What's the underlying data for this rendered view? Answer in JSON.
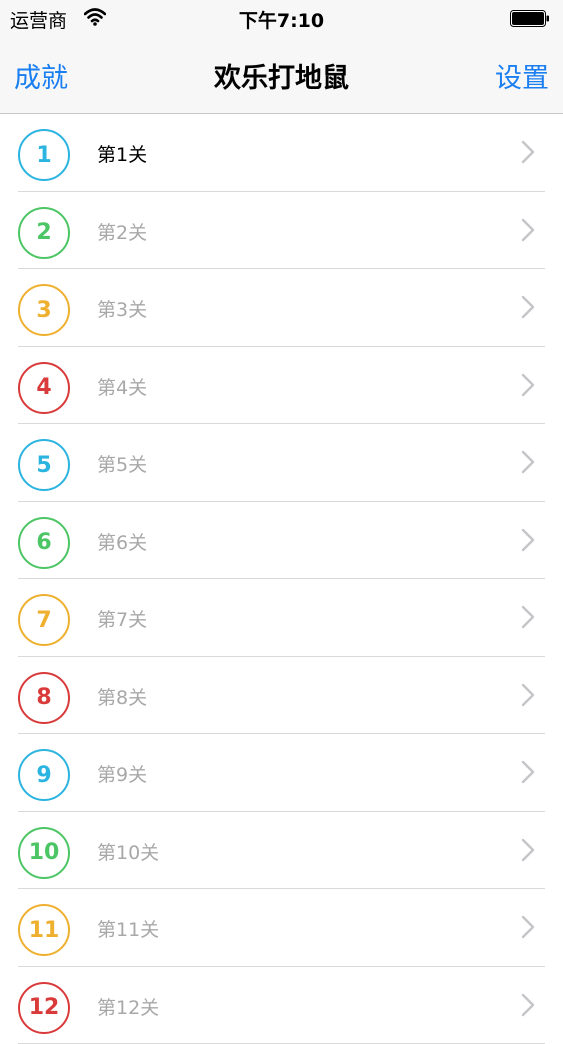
{
  "status": {
    "carrier": "运营商",
    "time": "下午7:10"
  },
  "nav": {
    "left": "成就",
    "title": "欢乐打地鼠",
    "right": "设置"
  },
  "palette": [
    "#2cb4e0",
    "#4cc564",
    "#efb030",
    "#d93a3a"
  ],
  "levels": [
    {
      "num": "1",
      "label": "第1关",
      "unlocked": true
    },
    {
      "num": "2",
      "label": "第2关",
      "unlocked": false
    },
    {
      "num": "3",
      "label": "第3关",
      "unlocked": false
    },
    {
      "num": "4",
      "label": "第4关",
      "unlocked": false
    },
    {
      "num": "5",
      "label": "第5关",
      "unlocked": false
    },
    {
      "num": "6",
      "label": "第6关",
      "unlocked": false
    },
    {
      "num": "7",
      "label": "第7关",
      "unlocked": false
    },
    {
      "num": "8",
      "label": "第8关",
      "unlocked": false
    },
    {
      "num": "9",
      "label": "第9关",
      "unlocked": false
    },
    {
      "num": "10",
      "label": "第10关",
      "unlocked": false
    },
    {
      "num": "11",
      "label": "第11关",
      "unlocked": false
    },
    {
      "num": "12",
      "label": "第12关",
      "unlocked": false
    }
  ]
}
